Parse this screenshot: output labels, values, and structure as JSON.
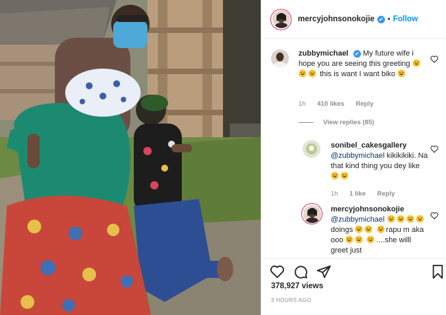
{
  "header": {
    "username": "mercyjohnsonokojie",
    "verified_mark": "✔",
    "separator": "•",
    "follow_label": "Follow"
  },
  "comments": [
    {
      "username": "zubbymichael",
      "verified_mark": "✔",
      "text_a": "My future wife i hope you are seeing this greeting",
      "text_b": "this is want I want biko",
      "time": "1h",
      "likes": "410 likes",
      "reply_label": "Reply",
      "view_replies": "View replies (85)"
    },
    {
      "username": "sonibel_cakesgallery",
      "mention": "@zubbymichael",
      "text_a": "kikikikiki. Na that kind thing you dey like",
      "time": "1h",
      "likes": "1 like",
      "reply_label": "Reply"
    },
    {
      "username": "mercyjohnsonokojie",
      "mention": "@zubbymichael",
      "text_a": "doings",
      "text_b": "rapu m aka ooo",
      "text_c": "....she willl greet just"
    }
  ],
  "footer": {
    "views": "378,927 views",
    "time_ago": "3 HOURS AGO"
  },
  "icons": [
    "heart-icon",
    "comment-icon",
    "share-icon",
    "bookmark-icon",
    "verified-icon"
  ],
  "colors": {
    "follow": "#0095f6",
    "verified": "#3897f0",
    "meta": "#8e8e8e",
    "mention": "#00376b"
  }
}
